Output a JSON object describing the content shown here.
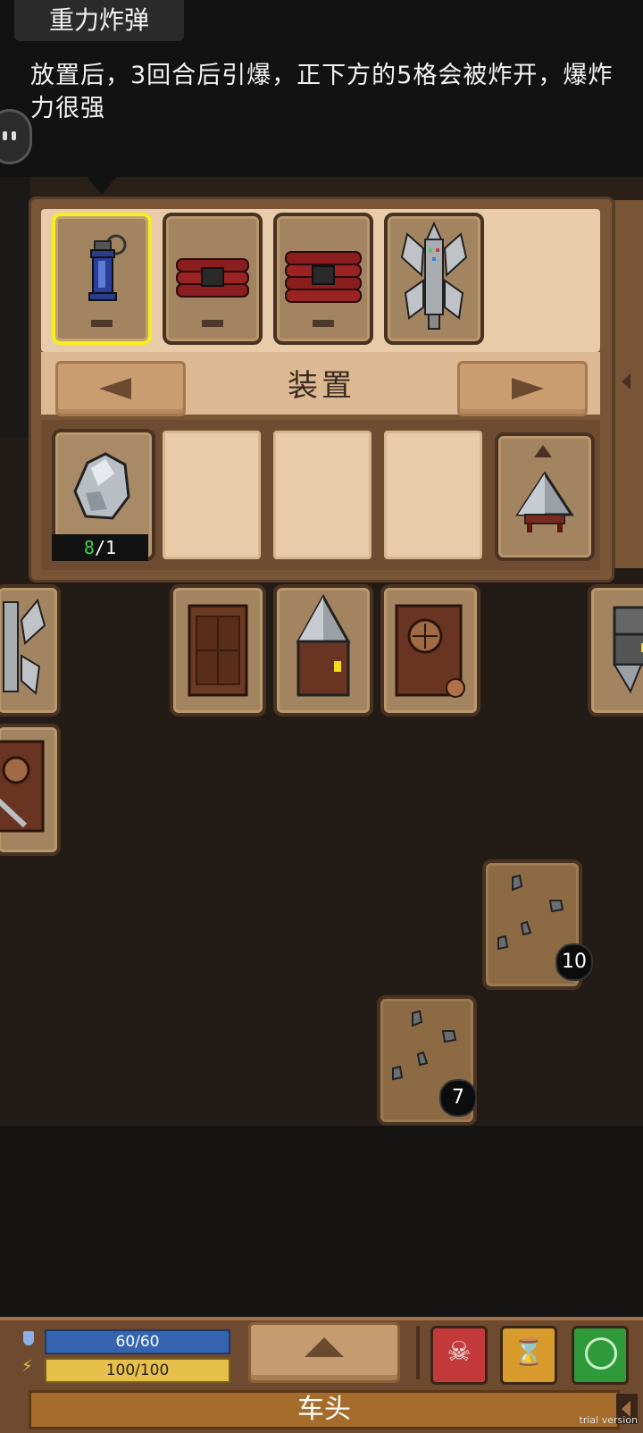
{
  "tooltip": {
    "title": "重力炸弹",
    "description": "放置后，3回合后引爆，正下方的5格会被炸开，爆炸力很强"
  },
  "inventory": {
    "category_title": "装置",
    "top_items": [
      {
        "name": "重力炸弹",
        "icon": "gravity-bomb-icon",
        "selected": true
      },
      {
        "name": "",
        "icon": "dynamite-icon",
        "selected": false
      },
      {
        "name": "",
        "icon": "dynamite-bundle-icon",
        "selected": false
      },
      {
        "name": "",
        "icon": "drill-tower-icon",
        "selected": false
      }
    ],
    "material": {
      "icon": "ore-chunk-icon",
      "have": "8",
      "need": "/1"
    }
  },
  "board": {
    "ore_blocks": [
      {
        "count": "10"
      },
      {
        "count": "7"
      }
    ]
  },
  "hud": {
    "hp": "60/60",
    "energy": "100/100",
    "location": "车头",
    "trial_text": "trial version",
    "buttons": [
      "skull-button",
      "hourglass-button",
      "compass-button"
    ]
  },
  "colors": {
    "selected_border": "#f5ef1a",
    "hp_bar": "#3564b0",
    "energy_bar": "#e6c04a",
    "material_count": "#3bd24b"
  }
}
